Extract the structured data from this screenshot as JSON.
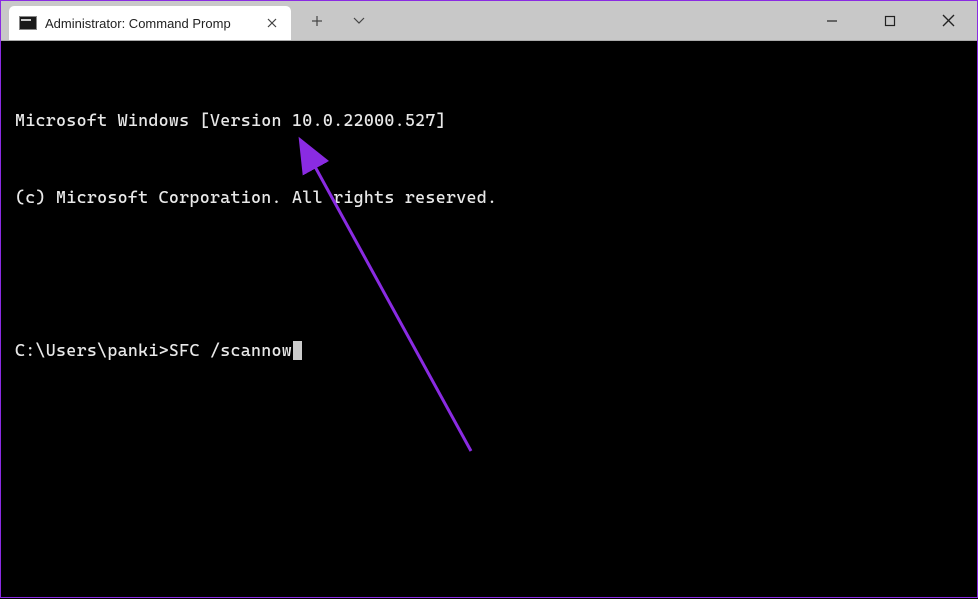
{
  "window": {
    "tab_title": "Administrator: Command Promp"
  },
  "terminal": {
    "line1": "Microsoft Windows [Version 10.0.22000.527]",
    "line2": "(c) Microsoft Corporation. All rights reserved.",
    "prompt": "C:\\Users\\panki>",
    "command": "SFC /scannow"
  },
  "annotation": {
    "color": "#8a2be2"
  }
}
